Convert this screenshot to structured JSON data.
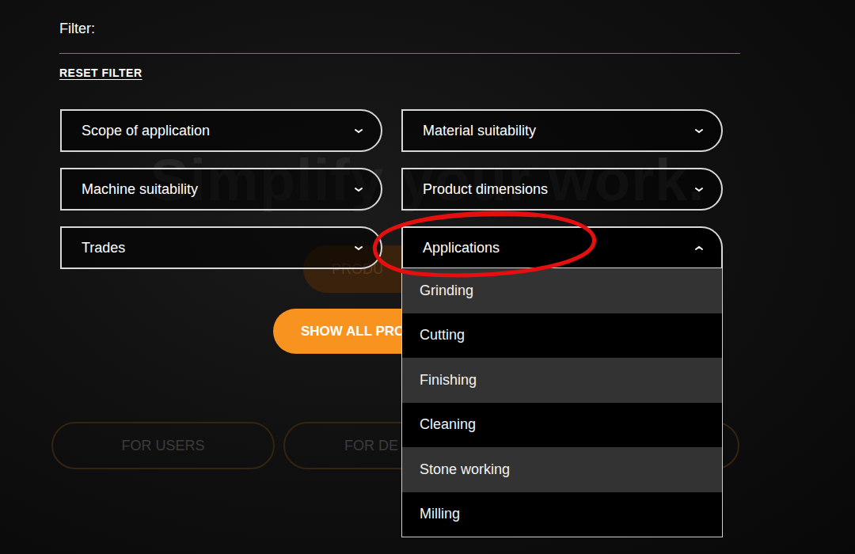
{
  "filter": {
    "title": "Filter:",
    "reset": "RESET FILTER"
  },
  "dropdowns": [
    {
      "label": "Scope of application",
      "expanded": false
    },
    {
      "label": "Material suitability",
      "expanded": false
    },
    {
      "label": "Machine suitability",
      "expanded": false
    },
    {
      "label": "Product dimensions",
      "expanded": false
    },
    {
      "label": "Trades",
      "expanded": false
    },
    {
      "label": "Applications",
      "expanded": true,
      "options": [
        "Grinding",
        "Cutting",
        "Finishing",
        "Cleaning",
        "Stone working",
        "Milling"
      ]
    }
  ],
  "background": {
    "watermark": "Simplify your work.",
    "buttons": [
      {
        "label": "PRODU",
        "kind": "prod"
      },
      {
        "label": "SHOW ALL PRO",
        "kind": "show"
      },
      {
        "label": "FOR USERS",
        "kind": "users"
      },
      {
        "label": "FOR DE",
        "kind": "de"
      },
      {
        "label": "",
        "kind": "third"
      }
    ]
  }
}
